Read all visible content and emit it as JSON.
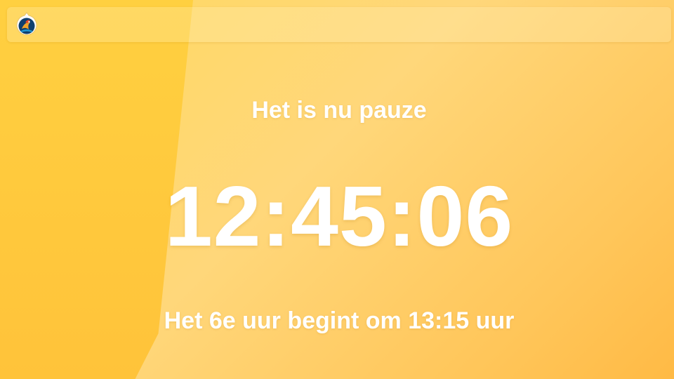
{
  "header": {
    "logo_icon": "school-crest-icon"
  },
  "main": {
    "status": "Het is nu pauze",
    "clock": "12:45:06",
    "next_period": "Het 6e uur begint om 13:15 uur"
  },
  "colors": {
    "background": "#ffd77a",
    "accent": "#ffc33a",
    "text": "#ffffff"
  }
}
